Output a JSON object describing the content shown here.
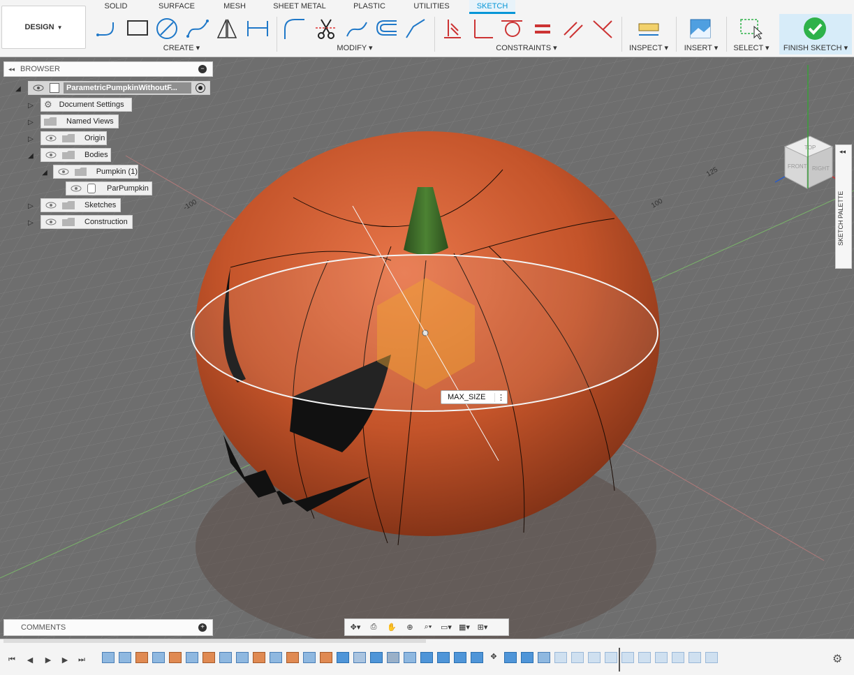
{
  "toolbar": {
    "design_label": "DESIGN",
    "tabs": [
      "SOLID",
      "SURFACE",
      "MESH",
      "SHEET METAL",
      "PLASTIC",
      "UTILITIES",
      "SKETCH"
    ],
    "active_tab": "SKETCH",
    "groups": {
      "create": "CREATE",
      "modify": "MODIFY",
      "constraints": "CONSTRAINTS",
      "inspect": "INSPECT",
      "insert": "INSERT",
      "select": "SELECT",
      "finish": "FINISH SKETCH"
    },
    "accent": "#0696d7",
    "finish_color": "#2eb24a"
  },
  "browser": {
    "title": "BROWSER",
    "root": "ParametricPumpkinWithoutF...",
    "items": [
      {
        "label": "Document Settings",
        "icon": "gear-icon"
      },
      {
        "label": "Named Views",
        "icon": "folder-icon"
      },
      {
        "label": "Origin",
        "icon": "folder-icon"
      },
      {
        "label": "Bodies",
        "icon": "folder-icon"
      },
      {
        "label": "Pumpkin (1)",
        "icon": "folder-icon"
      },
      {
        "label": "ParPumpkin",
        "icon": "body-icon"
      },
      {
        "label": "Sketches",
        "icon": "folder-icon"
      },
      {
        "label": "Construction",
        "icon": "folder-icon"
      }
    ]
  },
  "viewport": {
    "dimension_label": "MAX_SIZE",
    "grid_labels": [
      "-100",
      "100",
      "125"
    ],
    "view_cube": {
      "top": "TOP",
      "front": "FRONT",
      "right": "RIGHT"
    },
    "pumpkin_color": "#c4542a",
    "stem_color": "#3d6b2a"
  },
  "sketch_palette": {
    "label": "SKETCH PALETTE"
  },
  "comments": {
    "label": "COMMENTS"
  }
}
